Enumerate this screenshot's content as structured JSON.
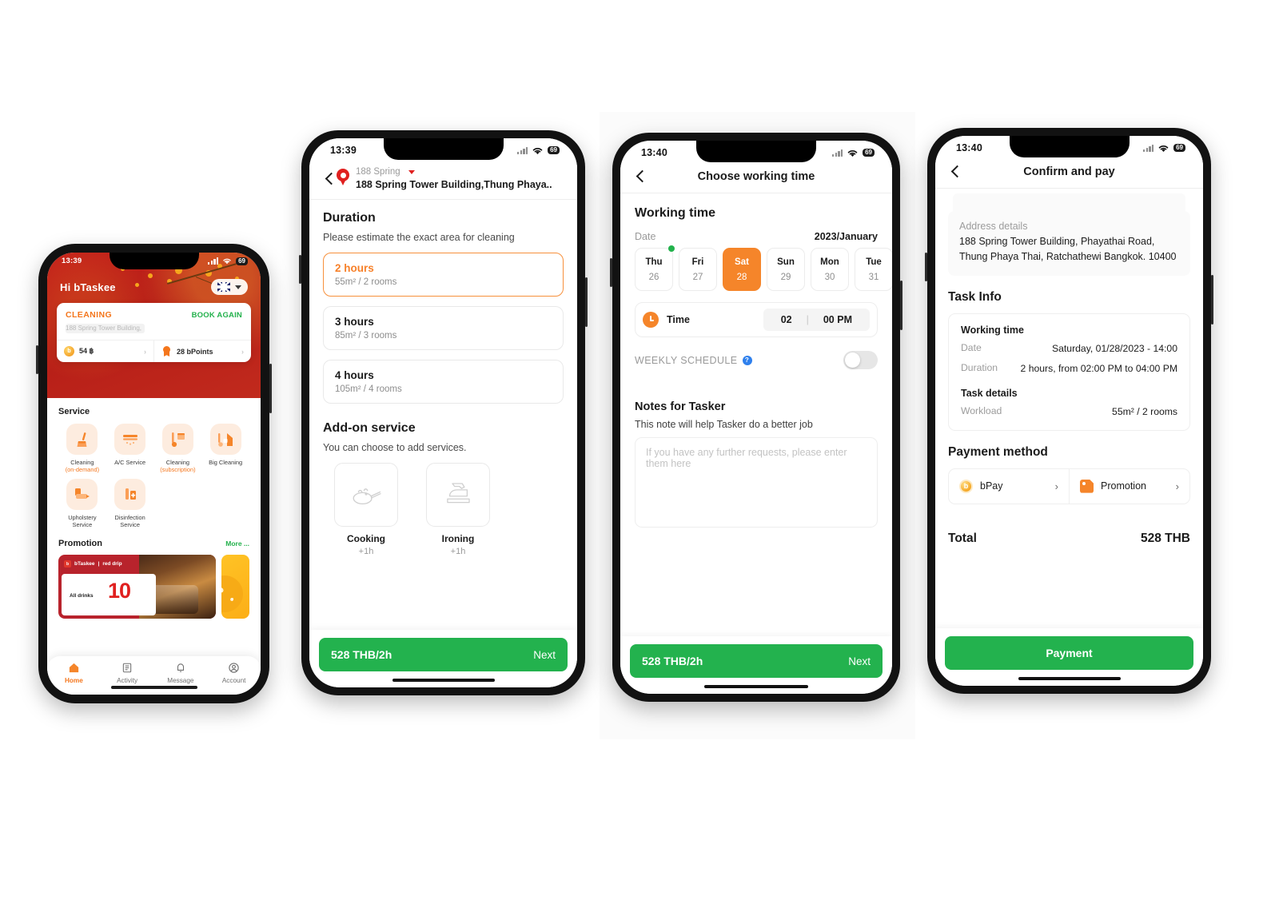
{
  "phone1": {
    "status": {
      "time": "13:39",
      "battery": "69"
    },
    "greeting": "Hi  bTaskee",
    "language": "en",
    "booking_card": {
      "service": "CLEANING",
      "address": "188 Spring Tower Building,",
      "book_again": "BOOK AGAIN",
      "wallet": "54 ฿",
      "points": "28 bPoints"
    },
    "service_section_title": "Service",
    "services": [
      {
        "label": "Cleaning",
        "sub": "(on-demand)",
        "icon": "broom-icon"
      },
      {
        "label": "A/C Service",
        "sub": "",
        "icon": "air-conditioner-icon"
      },
      {
        "label": "Cleaning",
        "sub": "(subscription)",
        "icon": "vacuum-calendar-icon"
      },
      {
        "label": "Big Cleaning",
        "sub": "",
        "icon": "house-vacuum-icon"
      },
      {
        "label": "Upholstery Service",
        "sub": "",
        "icon": "sofa-icon"
      },
      {
        "label": "Disinfection Service",
        "sub": "",
        "icon": "spray-bottle-icon"
      }
    ],
    "promotion_title": "Promotion",
    "promotion_more": "More ...",
    "promos": [
      {
        "brand": "bTaskee",
        "partner": "red drip",
        "caption": "All drinks",
        "discount": "10"
      },
      {
        "brand": "",
        "partner": "",
        "caption": "",
        "discount": ""
      }
    ],
    "tabs": [
      {
        "label": "Home",
        "icon": "home-icon",
        "active": true
      },
      {
        "label": "Activity",
        "icon": "list-icon",
        "active": false
      },
      {
        "label": "Message",
        "icon": "bell-icon",
        "active": false
      },
      {
        "label": "Account",
        "icon": "user-circle-icon",
        "active": false
      }
    ]
  },
  "phone2": {
    "status": {
      "time": "13:39",
      "battery": "69"
    },
    "location": {
      "name": "188 Spring",
      "full": "188 Spring Tower Building,Thung Phaya.."
    },
    "duration_title": "Duration",
    "duration_subtitle": "Please estimate the exact area for cleaning",
    "durations": [
      {
        "title": "2 hours",
        "detail": "55m² / 2 rooms",
        "selected": true
      },
      {
        "title": "3 hours",
        "detail": "85m² / 3 rooms",
        "selected": false
      },
      {
        "title": "4 hours",
        "detail": "105m² / 4 rooms",
        "selected": false
      }
    ],
    "addon_title": "Add-on service",
    "addon_subtitle": "You can choose to add services.",
    "addons": [
      {
        "name": "Cooking",
        "price": "+1h",
        "icon": "pan-icon"
      },
      {
        "name": "Ironing",
        "price": "+1h",
        "icon": "iron-icon"
      }
    ],
    "footer": {
      "price": "528 THB/2h",
      "next": "Next"
    }
  },
  "phone3": {
    "status": {
      "time": "13:40",
      "battery": "69"
    },
    "nav_title": "Choose working time",
    "section_title": "Working time",
    "date_label": "Date",
    "month_year": "2023/January",
    "days": [
      {
        "dow": "Thu",
        "num": "26",
        "selected": false,
        "dot": true
      },
      {
        "dow": "Fri",
        "num": "27",
        "selected": false,
        "dot": false
      },
      {
        "dow": "Sat",
        "num": "28",
        "selected": true,
        "dot": false
      },
      {
        "dow": "Sun",
        "num": "29",
        "selected": false,
        "dot": false
      },
      {
        "dow": "Mon",
        "num": "30",
        "selected": false,
        "dot": false
      },
      {
        "dow": "Tue",
        "num": "31",
        "selected": false,
        "dot": false
      }
    ],
    "time_label": "Time",
    "time_hour": "02",
    "time_minute": "00 PM",
    "weekly_schedule_label": "WEEKLY SCHEDULE",
    "weekly_schedule_on": false,
    "notes_title": "Notes for Tasker",
    "notes_subtitle": "This note will help Tasker do a better job",
    "notes_placeholder": "If you have any further requests, please enter them here",
    "notes_value": "",
    "footer": {
      "price": "528 THB/2h",
      "next": "Next"
    }
  },
  "phone4": {
    "status": {
      "time": "13:40",
      "battery": "69"
    },
    "nav_title": "Confirm and pay",
    "address_label": "Address details",
    "address_value": "188 Spring Tower Building, Phayathai Road, Thung Phaya Thai, Ratchathewi Bangkok. 10400",
    "task_info_title": "Task Info",
    "working_time_title": "Working time",
    "rows": [
      {
        "key": "Date",
        "value": "Saturday, 01/28/2023 - 14:00"
      },
      {
        "key": "Duration",
        "value": "2 hours, from 02:00 PM to 04:00 PM"
      }
    ],
    "task_details_title": "Task details",
    "task_details_rows": [
      {
        "key": "Workload",
        "value": "55m² / 2 rooms"
      }
    ],
    "payment_method_title": "Payment method",
    "payment_options": [
      {
        "label": "bPay",
        "icon": "bpay-coin-icon"
      },
      {
        "label": "Promotion",
        "icon": "promo-tag-icon"
      }
    ],
    "total_label": "Total",
    "total_value": "528 THB",
    "payment_button": "Payment"
  },
  "colors": {
    "brand_orange": "#f5852a",
    "brand_green": "#23b24e",
    "hero_red": "#c4211b",
    "accent_yellow": "#f5a623"
  }
}
